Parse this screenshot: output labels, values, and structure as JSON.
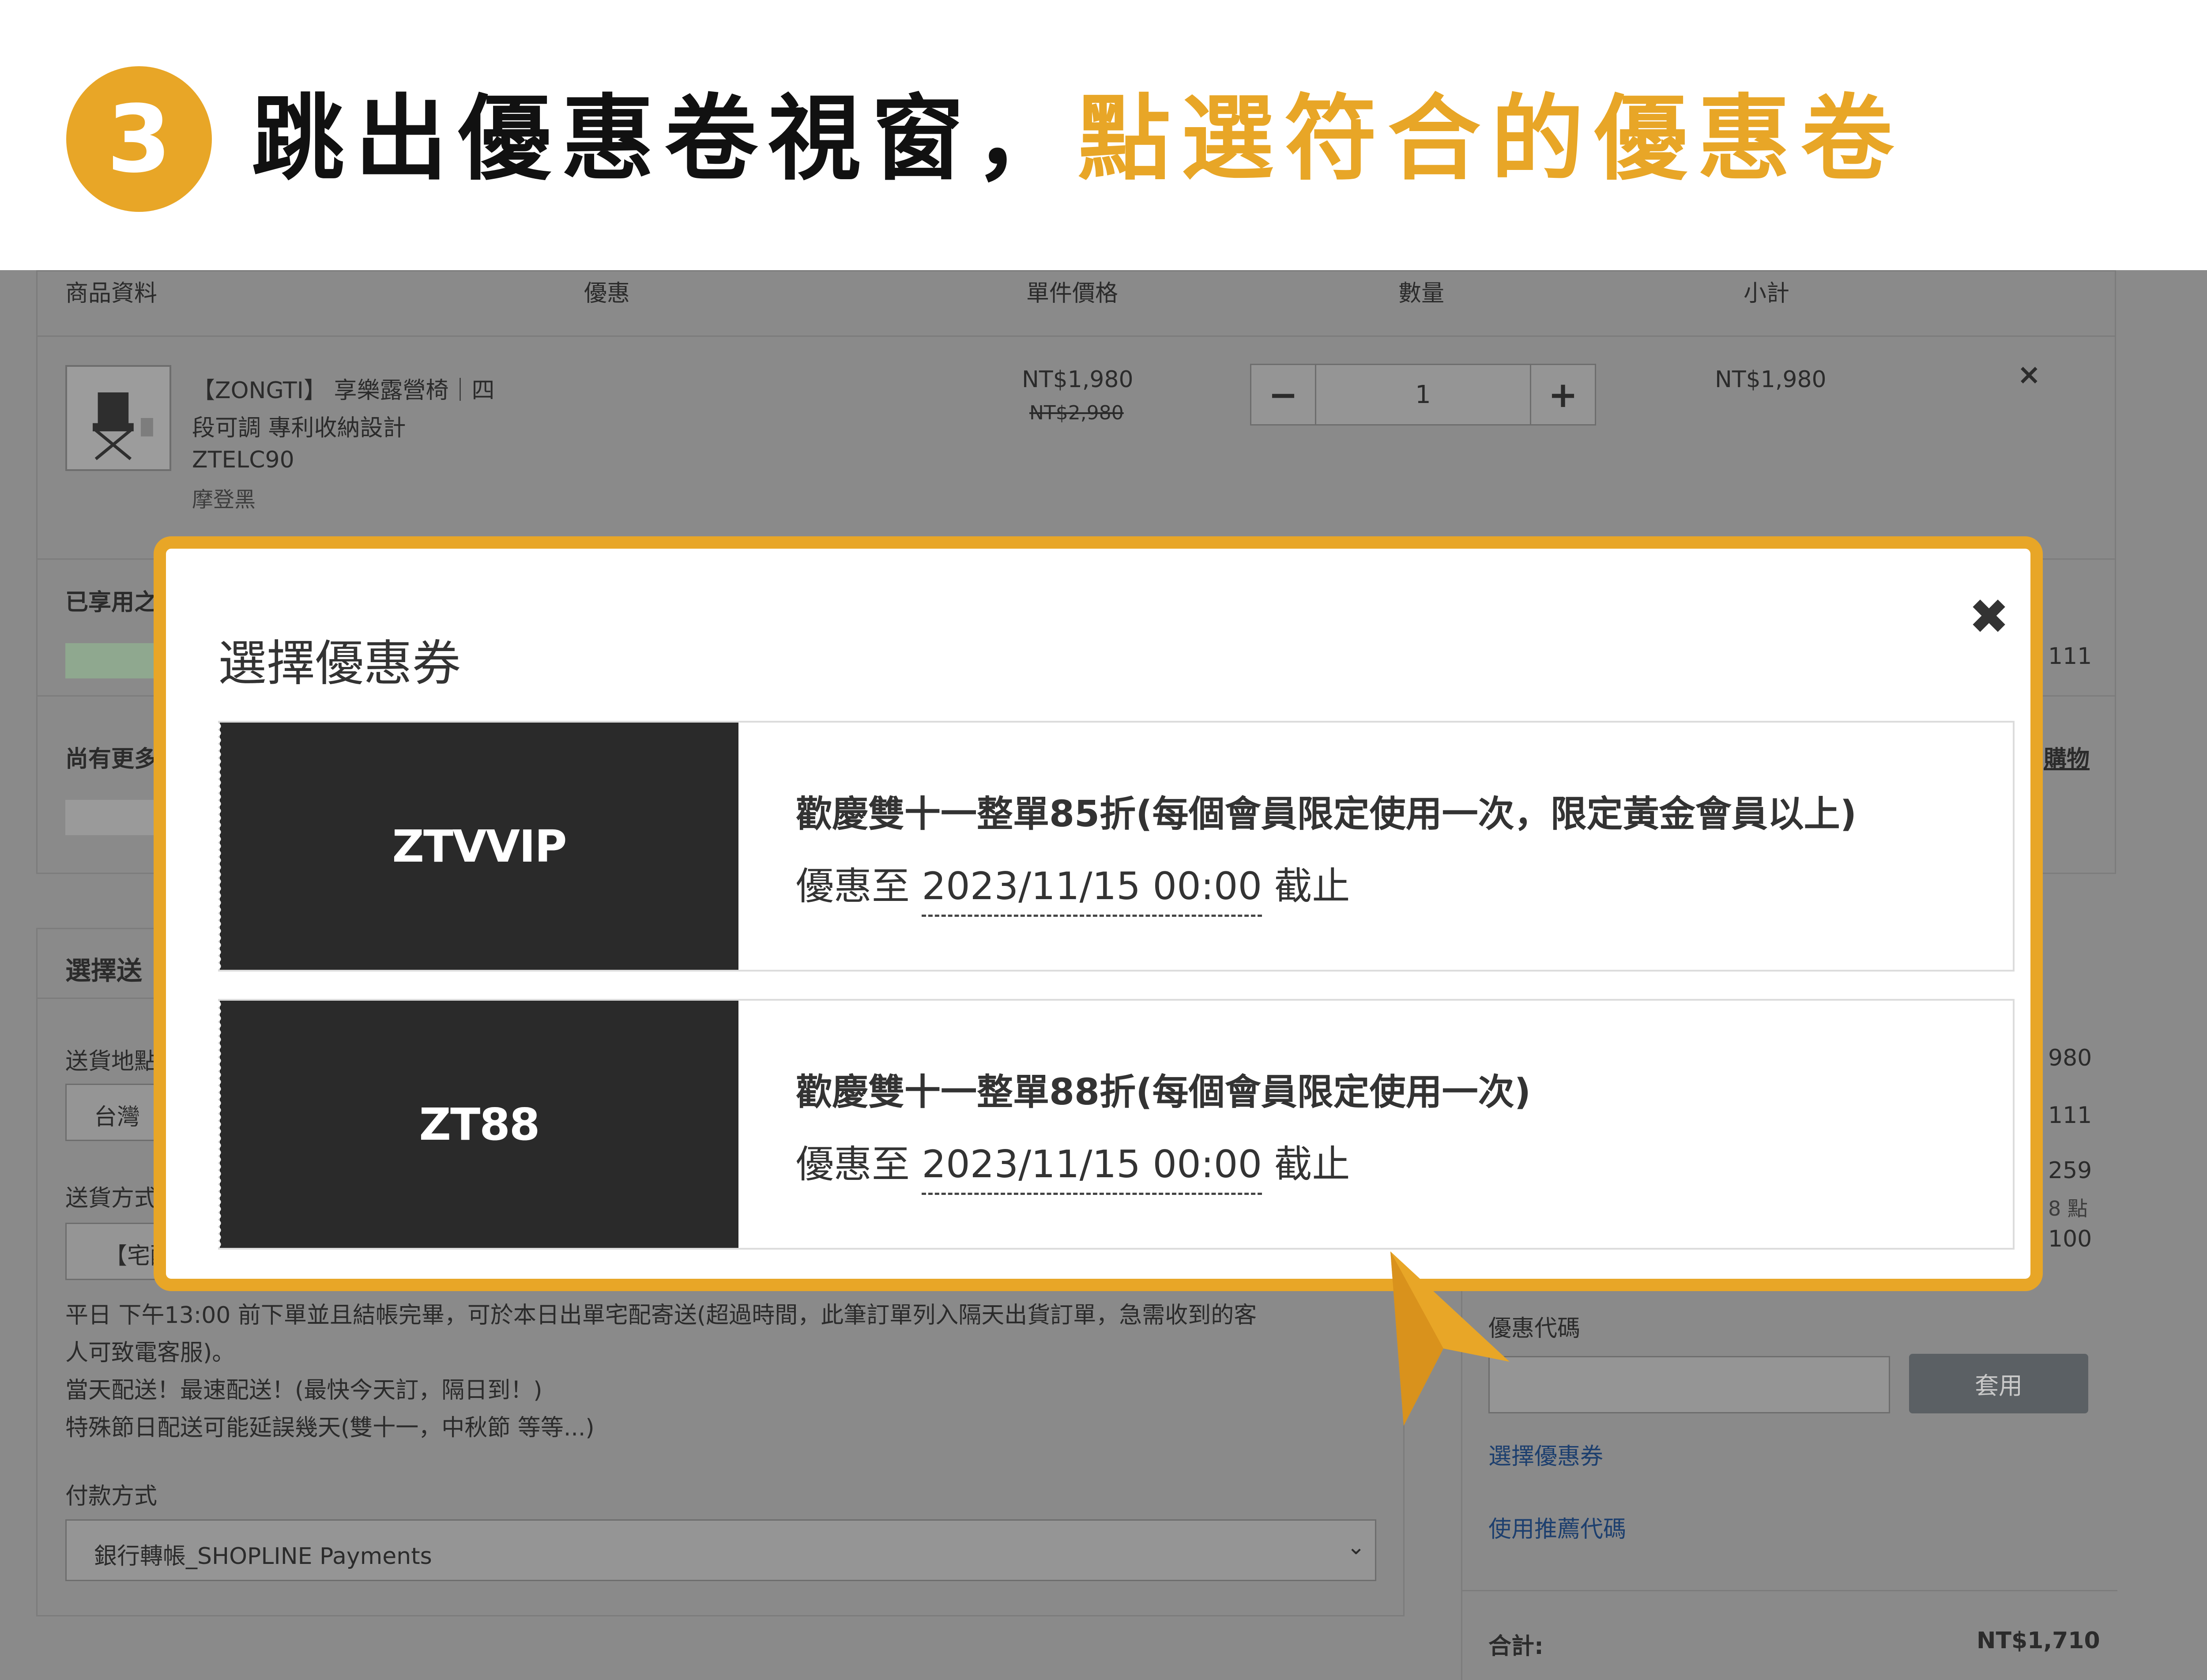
{
  "banner": {
    "step_number": "3",
    "headline_dark": "跳出優惠卷視窗，",
    "headline_accent": "點選符合的優惠卷"
  },
  "cart": {
    "columns": [
      "商品資料",
      "優惠",
      "單件價格",
      "數量",
      "小計"
    ],
    "product": {
      "name_line1": "【ZONGTI】 享樂露營椅｜四",
      "name_line2": "段可調 專利收納設計",
      "sku": "ZTELC90",
      "variant": "摩登黑",
      "price": "NT$1,980",
      "original_price": "NT$2,980",
      "quantity": "1",
      "subtotal": "NT$1,980",
      "remove_icon": "×"
    },
    "promo_applied_label": "已享用之",
    "more_offers_label": "尚有更多",
    "more_offers_link": "購物",
    "promo_amount": "111"
  },
  "shipping": {
    "section_title": "選擇送",
    "region_label": "送貨地點",
    "region_value": "台灣",
    "method_label": "送貨方式",
    "method_value": "【宅配",
    "notes": [
      "平日 下午13:00 前下單並且結帳完畢，可於本日出單宅配寄送(超過時間，此筆訂單列入隔天出貨訂單，急需收到的客",
      "人可致電客服)。",
      "當天配送！最速配送！(最快今天訂，隔日到！)",
      "特殊節日配送可能延誤幾天(雙十一，中秋節 等等...)"
    ],
    "payment_label": "付款方式",
    "payment_value": "銀行轉帳_SHOPLINE Payments"
  },
  "summary": {
    "partial_values": [
      "980",
      "111",
      "259",
      "8 點",
      "100"
    ],
    "coupon_code_label": "優惠代碼",
    "apply_button": "套用",
    "select_coupon_link": "選擇優惠券",
    "referral_link": "使用推薦代碼",
    "total_label": "合計:",
    "total_value": "NT$1,710"
  },
  "modal": {
    "title": "選擇優惠券",
    "close_icon": "✖",
    "coupons": [
      {
        "code": "ZTVVIP",
        "description": "歡慶雙十一整單85折(每個會員限定使用一次，限定黃金會員以上)",
        "expiry_prefix": "優惠至",
        "expiry_date": "2023/11/15 00:00",
        "expiry_suffix": "截止"
      },
      {
        "code": "ZT88",
        "description": "歡慶雙十一整單88折(每個會員限定使用一次)",
        "expiry_prefix": "優惠至",
        "expiry_date": "2023/11/15 00:00",
        "expiry_suffix": "截止"
      }
    ]
  },
  "colors": {
    "accent": "#e8a627",
    "overlay_gray": "#8a8a8a",
    "coupon_stub": "#2a2a2a",
    "pointer": "#e8a627"
  }
}
